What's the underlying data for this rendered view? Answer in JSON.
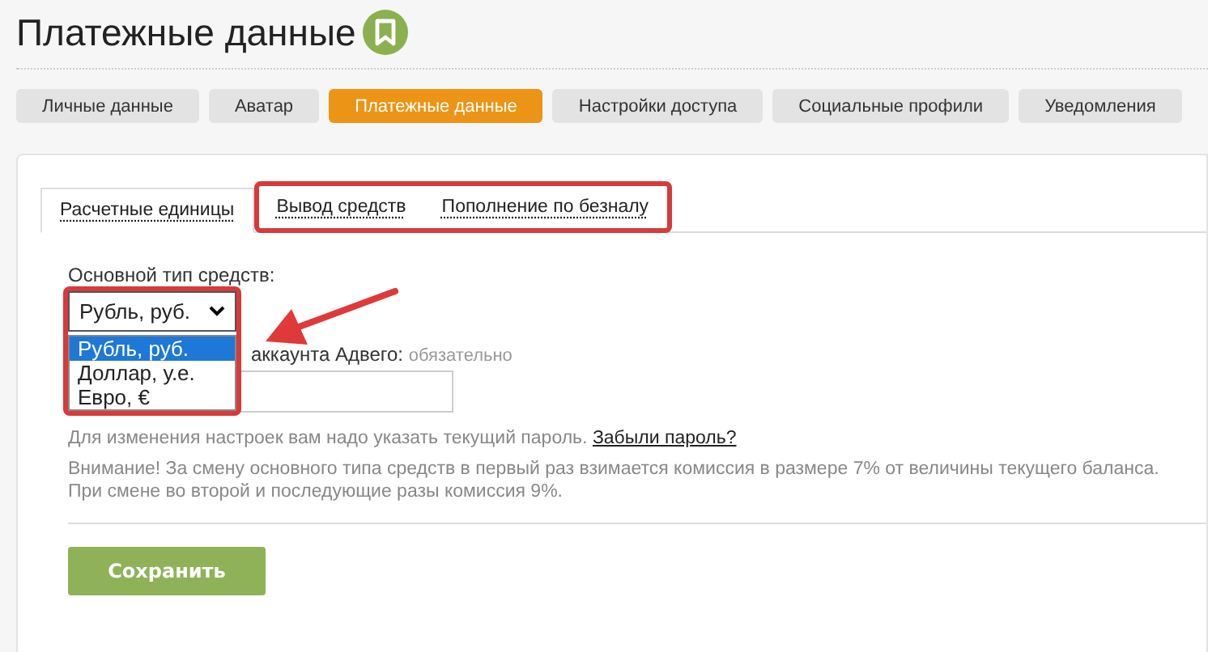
{
  "page_title": "Платежные данные",
  "tabs": [
    {
      "label": "Личные данные",
      "selected": false
    },
    {
      "label": "Аватар",
      "selected": false
    },
    {
      "label": "Платежные данные",
      "selected": true
    },
    {
      "label": "Настройки доступа",
      "selected": false
    },
    {
      "label": "Социальные профили",
      "selected": false
    },
    {
      "label": "Уведомления",
      "selected": false
    }
  ],
  "subtabs": [
    {
      "label": "Расчетные единицы",
      "selected": true
    },
    {
      "label": "Вывод средств",
      "selected": false
    },
    {
      "label": "Пополнение по безналу",
      "selected": false
    }
  ],
  "currency": {
    "label": "Основной тип средств:",
    "value": "Рубль, руб.",
    "expanded": true,
    "options": [
      {
        "label": "Рубль, руб.",
        "selected": true
      },
      {
        "label": "Доллар, у.е.",
        "selected": false
      },
      {
        "label": "Евро, €",
        "selected": false
      }
    ]
  },
  "password": {
    "label": "аккаунта Адвего:",
    "required": "обязательно"
  },
  "hint": {
    "text": "Для изменения настроек вам надо указать текущий пароль.",
    "link": "Забыли пароль?"
  },
  "warning": [
    "Внимание! За смену основного типа средств в первый раз взимается комиссия в размере 7% от величины текущего баланса.",
    "При смене во второй и последующие разы комиссия 9%."
  ],
  "save_button": "Сохранить"
}
